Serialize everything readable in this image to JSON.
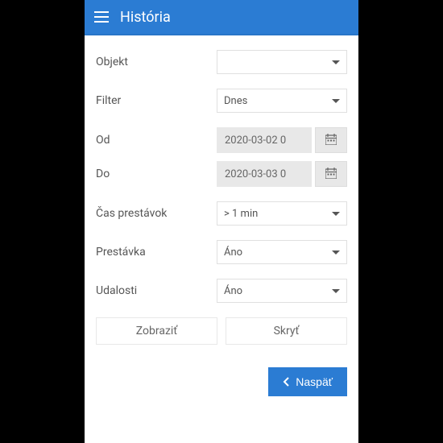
{
  "header": {
    "title": "História"
  },
  "fields": {
    "object": {
      "label": "Objekt",
      "value": ""
    },
    "filter": {
      "label": "Filter",
      "value": "Dnes"
    },
    "from": {
      "label": "Od",
      "value": "2020-03-02 0"
    },
    "to": {
      "label": "Do",
      "value": "2020-03-03 0"
    },
    "breaks_time": {
      "label": "Čas prestávok",
      "value": "> 1 min"
    },
    "break": {
      "label": "Prestávka",
      "value": "Áno"
    },
    "events": {
      "label": "Udalosti",
      "value": "Áno"
    }
  },
  "buttons": {
    "show": "Zobraziť",
    "hide": "Skryť",
    "back": "Naspäť"
  }
}
